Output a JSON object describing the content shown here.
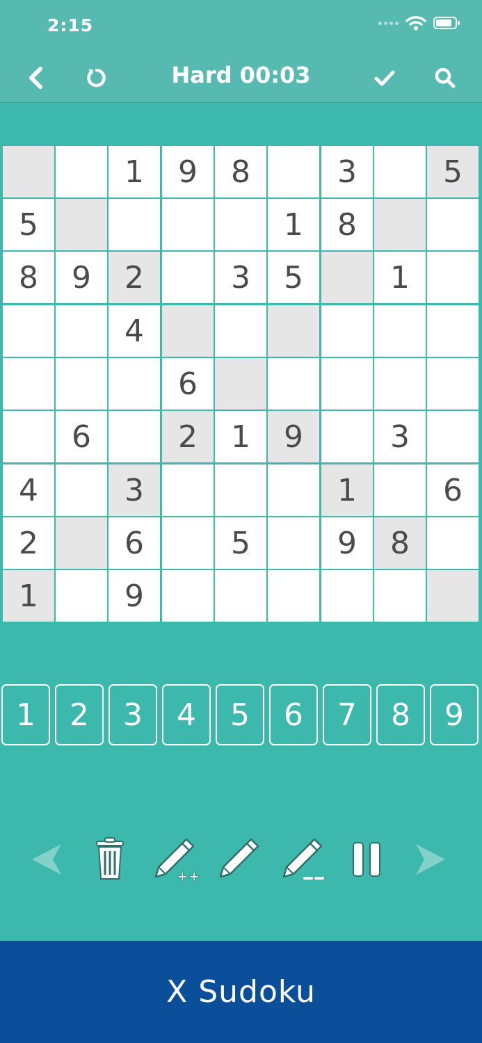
{
  "status_bar": {
    "time": "2:15"
  },
  "nav": {
    "title": "Hard 00:03"
  },
  "board": {
    "rows": [
      [
        "",
        "",
        "1",
        "9",
        "8",
        "",
        "3",
        "",
        "5"
      ],
      [
        "5",
        "",
        "",
        "",
        "",
        "1",
        "8",
        "",
        ""
      ],
      [
        "8",
        "9",
        "2",
        "",
        "3",
        "5",
        "",
        "1",
        ""
      ],
      [
        "",
        "",
        "4",
        "",
        "",
        "",
        "",
        "",
        ""
      ],
      [
        "",
        "",
        "",
        "6",
        "",
        "",
        "",
        "",
        ""
      ],
      [
        "",
        "6",
        "",
        "2",
        "1",
        "9",
        "",
        "3",
        ""
      ],
      [
        "4",
        "",
        "3",
        "",
        "",
        "",
        "1",
        "",
        "6"
      ],
      [
        "2",
        "",
        "6",
        "",
        "5",
        "",
        "9",
        "8",
        ""
      ],
      [
        "1",
        "",
        "9",
        "",
        "",
        "",
        "",
        "",
        ""
      ]
    ],
    "shaded": [
      [
        1,
        0,
        0,
        0,
        0,
        0,
        0,
        0,
        1
      ],
      [
        0,
        1,
        0,
        0,
        0,
        0,
        0,
        1,
        0
      ],
      [
        0,
        0,
        1,
        0,
        0,
        0,
        1,
        0,
        0
      ],
      [
        0,
        0,
        0,
        1,
        0,
        1,
        0,
        0,
        0
      ],
      [
        0,
        0,
        0,
        0,
        1,
        0,
        0,
        0,
        0
      ],
      [
        0,
        0,
        0,
        1,
        0,
        1,
        0,
        0,
        0
      ],
      [
        0,
        0,
        1,
        0,
        0,
        0,
        1,
        0,
        0
      ],
      [
        0,
        1,
        0,
        0,
        0,
        0,
        0,
        1,
        0
      ],
      [
        1,
        0,
        0,
        0,
        0,
        0,
        0,
        0,
        1
      ]
    ]
  },
  "numpad": [
    "1",
    "2",
    "3",
    "4",
    "5",
    "6",
    "7",
    "8",
    "9"
  ],
  "toolbar": {
    "icons": [
      "previous-arrow-icon",
      "trash-icon",
      "pencil-plus-icon",
      "pencil-icon",
      "pencil-minus-icon",
      "pause-icon",
      "next-arrow-icon"
    ]
  },
  "footer": {
    "title": "X Sudoku"
  },
  "colors": {
    "background": "#3db8ad",
    "header": "#57bab1",
    "footer": "#0b4f9a",
    "cell": "#ffffff",
    "shaded_cell": "#e6e6e6",
    "digit": "#4a4a4a"
  }
}
